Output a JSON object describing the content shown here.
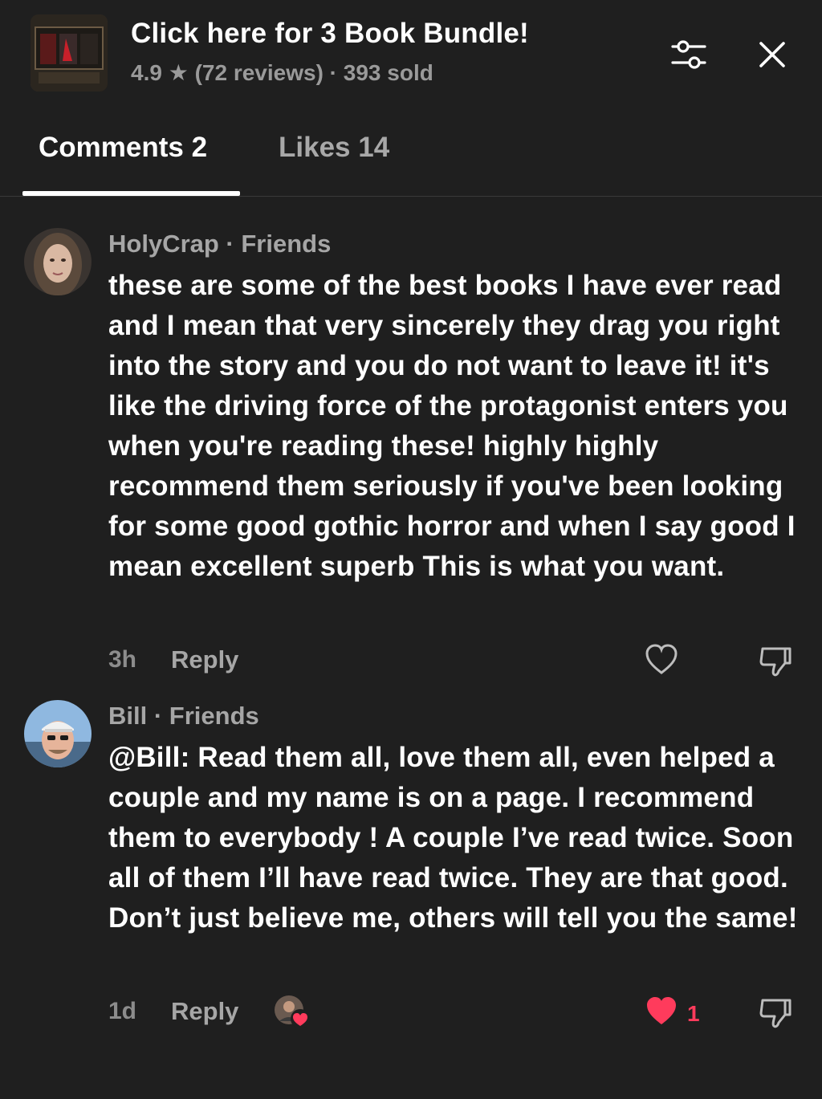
{
  "product": {
    "title": "Click here for 3 Book Bundle!",
    "meta": "4.9 ★ (72 reviews) · 393 sold"
  },
  "header": {
    "filter_icon": "sliders-icon",
    "close_icon": "close-icon"
  },
  "tabs": {
    "comments_label": "Comments 2",
    "likes_label": "Likes 14"
  },
  "comments": [
    {
      "author_line": "HolyCrap · Friends",
      "text": "these are some of the best books I have ever read and I mean that very sincerely they drag you right into the story and you do not want to leave it! it's like the driving force of the protagonist enters you when you're reading these! highly highly recommend them seriously if you've been looking for some good gothic horror and when I say good I mean excellent superb This is what you want.",
      "time": "3h",
      "reply_label": "Reply",
      "liked": false,
      "like_count": ""
    },
    {
      "author_line": "Bill · Friends",
      "text": "@Bill: Read them all, love them all, even helped a couple and my name is on a page. I recommend them to everybody ! A couple I’ve read twice. Soon all of them I’ll have read twice. They are that good. Don’t just believe me, others will tell you the same!",
      "time": "1d",
      "reply_label": "Reply",
      "liked": true,
      "like_count": "1"
    }
  ],
  "colors": {
    "background": "#1f1f1f",
    "like_red": "#ff3b5c",
    "secondary_text": "#a6a6a6"
  }
}
